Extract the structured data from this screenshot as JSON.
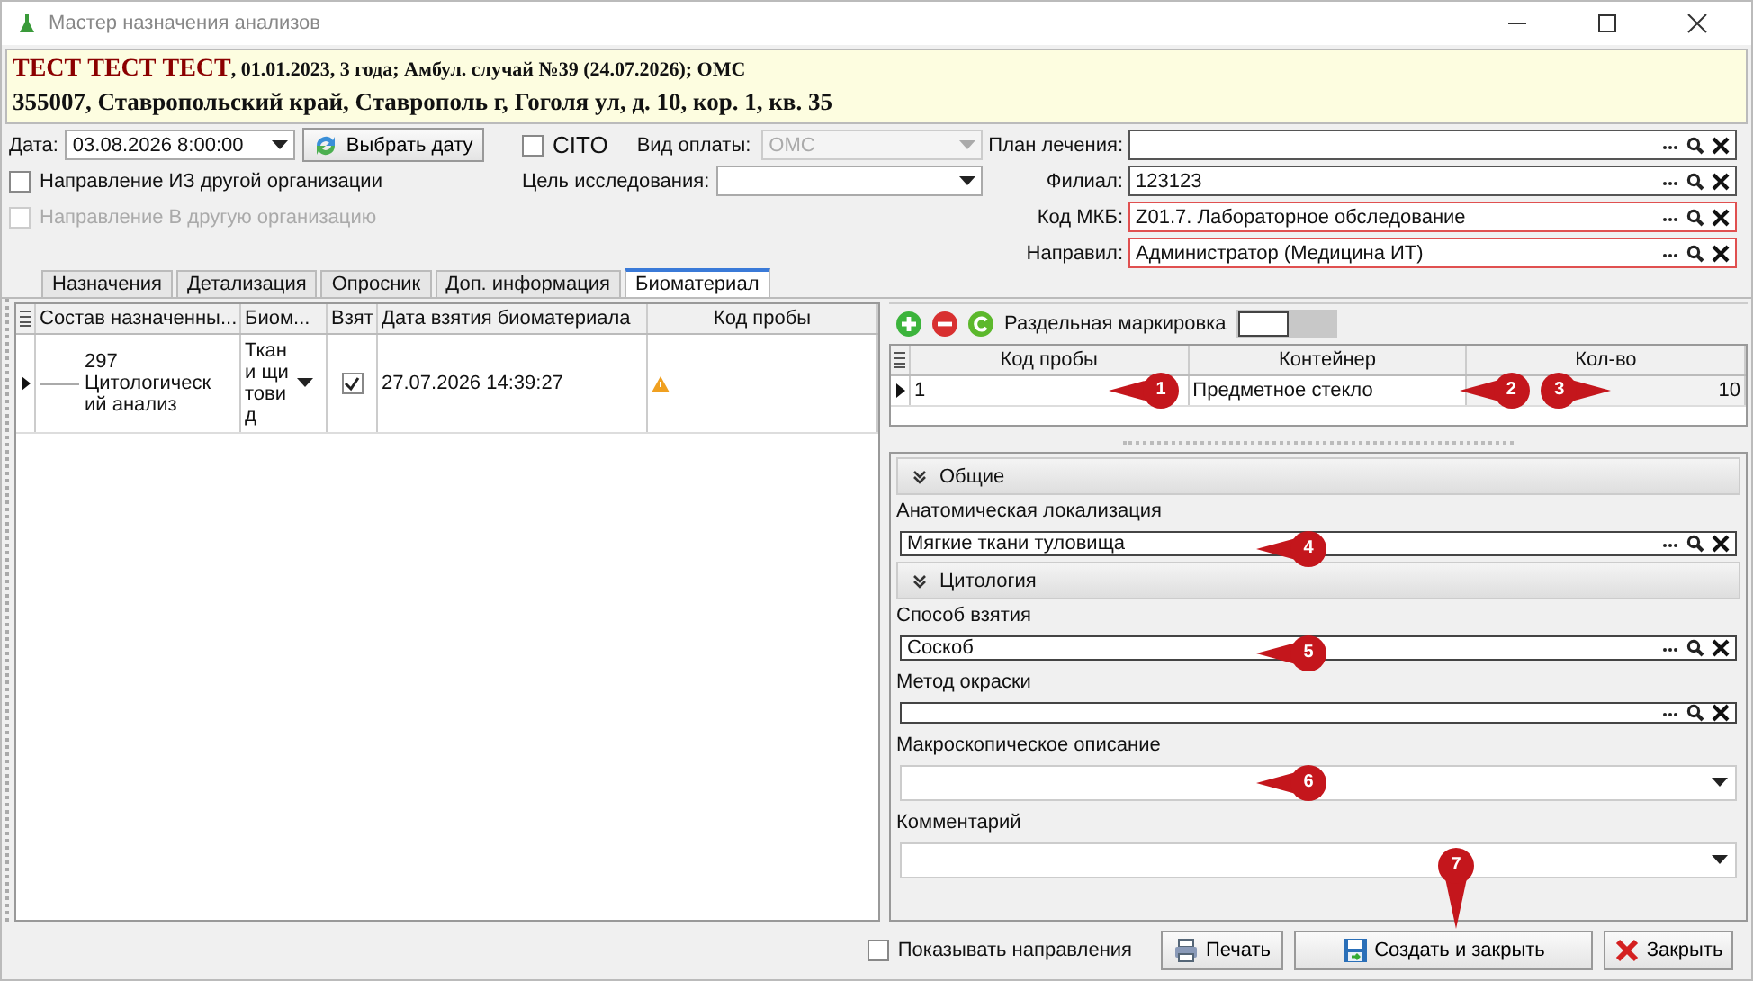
{
  "window": {
    "title": "Мастер назначения анализов"
  },
  "patient": {
    "name": "ТЕСТ ТЕСТ ТЕСТ",
    "details": ", 01.01.2023, 3 года; Амбул. случай №39 (24.07.2026); ОМС",
    "address": "355007, Ставропольский край, Ставрополь г, Гоголя ул, д. 10, кор. 1, кв. 35"
  },
  "form": {
    "date_label": "Дата:",
    "date_value": "03.08.2026 8:00:00",
    "pick_date_button": "Выбрать дату",
    "cito": {
      "label": "CITO",
      "checked": false
    },
    "payment": {
      "label": "Вид оплаты:",
      "value": "ОМС",
      "disabled": true
    },
    "goal": {
      "label": "Цель исследования:"
    },
    "checks": [
      {
        "label": "Направление ИЗ другой организации",
        "checked": false,
        "disabled": false
      },
      {
        "label": "Направление В другую организацию",
        "checked": false,
        "disabled": true
      }
    ]
  },
  "lookups": [
    {
      "label": "План лечения:",
      "invalid": false
    },
    {
      "label": "Филиал:",
      "value": "123123",
      "invalid": false
    },
    {
      "label": "Код МКБ:",
      "value": "Z01.7. Лабораторное обследование",
      "invalid": true
    },
    {
      "label": "Направил:",
      "value": "Администратор (Медицина ИТ)",
      "invalid": true
    }
  ],
  "tabs": [
    {
      "label": "Назначения",
      "selected": false
    },
    {
      "label": "Детализация",
      "selected": false
    },
    {
      "label": "Опросник",
      "selected": false
    },
    {
      "label": "Доп. информация",
      "selected": false
    },
    {
      "label": "Биоматериал",
      "selected": true
    }
  ],
  "orders": {
    "columns": [
      "Состав назначенны...",
      "Биом...",
      "Взят",
      "Дата взятия биоматериала",
      "Код пробы"
    ],
    "rows": [
      {
        "code": "297",
        "name": "Цитологический анализ",
        "biomaterial": "Ткани щитовид",
        "taken": true,
        "date": "27.07.2026 14:39:27",
        "warning": true
      }
    ]
  },
  "samples": {
    "toggle_label": "Раздельная маркировка",
    "toggle_on": false,
    "columns": [
      "Код пробы",
      "Контейнер",
      "Кол-во"
    ],
    "rows": [
      {
        "code": "1",
        "container": "Предметное стекло",
        "quantity": "10",
        "markers": [
          "1",
          "2",
          "3"
        ]
      }
    ]
  },
  "sections": [
    {
      "title": "Общие",
      "fields": [
        {
          "label": "Анатомическая локализация",
          "kind": "lookup",
          "value": "Мягкие ткани туловища",
          "marker": "4"
        }
      ]
    },
    {
      "title": "Цитология",
      "fields": [
        {
          "label": "Способ взятия",
          "kind": "lookup",
          "value": "Соскоб",
          "marker": "5"
        },
        {
          "label": "Метод окраски",
          "kind": "lookup"
        },
        {
          "label": "Макроскопическое описание",
          "kind": "dropdown",
          "marker": "6"
        },
        {
          "label": "Комментарий",
          "kind": "dropdown"
        }
      ]
    }
  ],
  "footer": {
    "show_directions": {
      "label": "Показывать направления",
      "checked": false
    },
    "buttons": [
      {
        "label": "Печать",
        "kind": "print"
      },
      {
        "label": "Создать и закрыть",
        "kind": "save",
        "marker": "7"
      },
      {
        "label": "Закрыть",
        "kind": "close"
      }
    ]
  }
}
